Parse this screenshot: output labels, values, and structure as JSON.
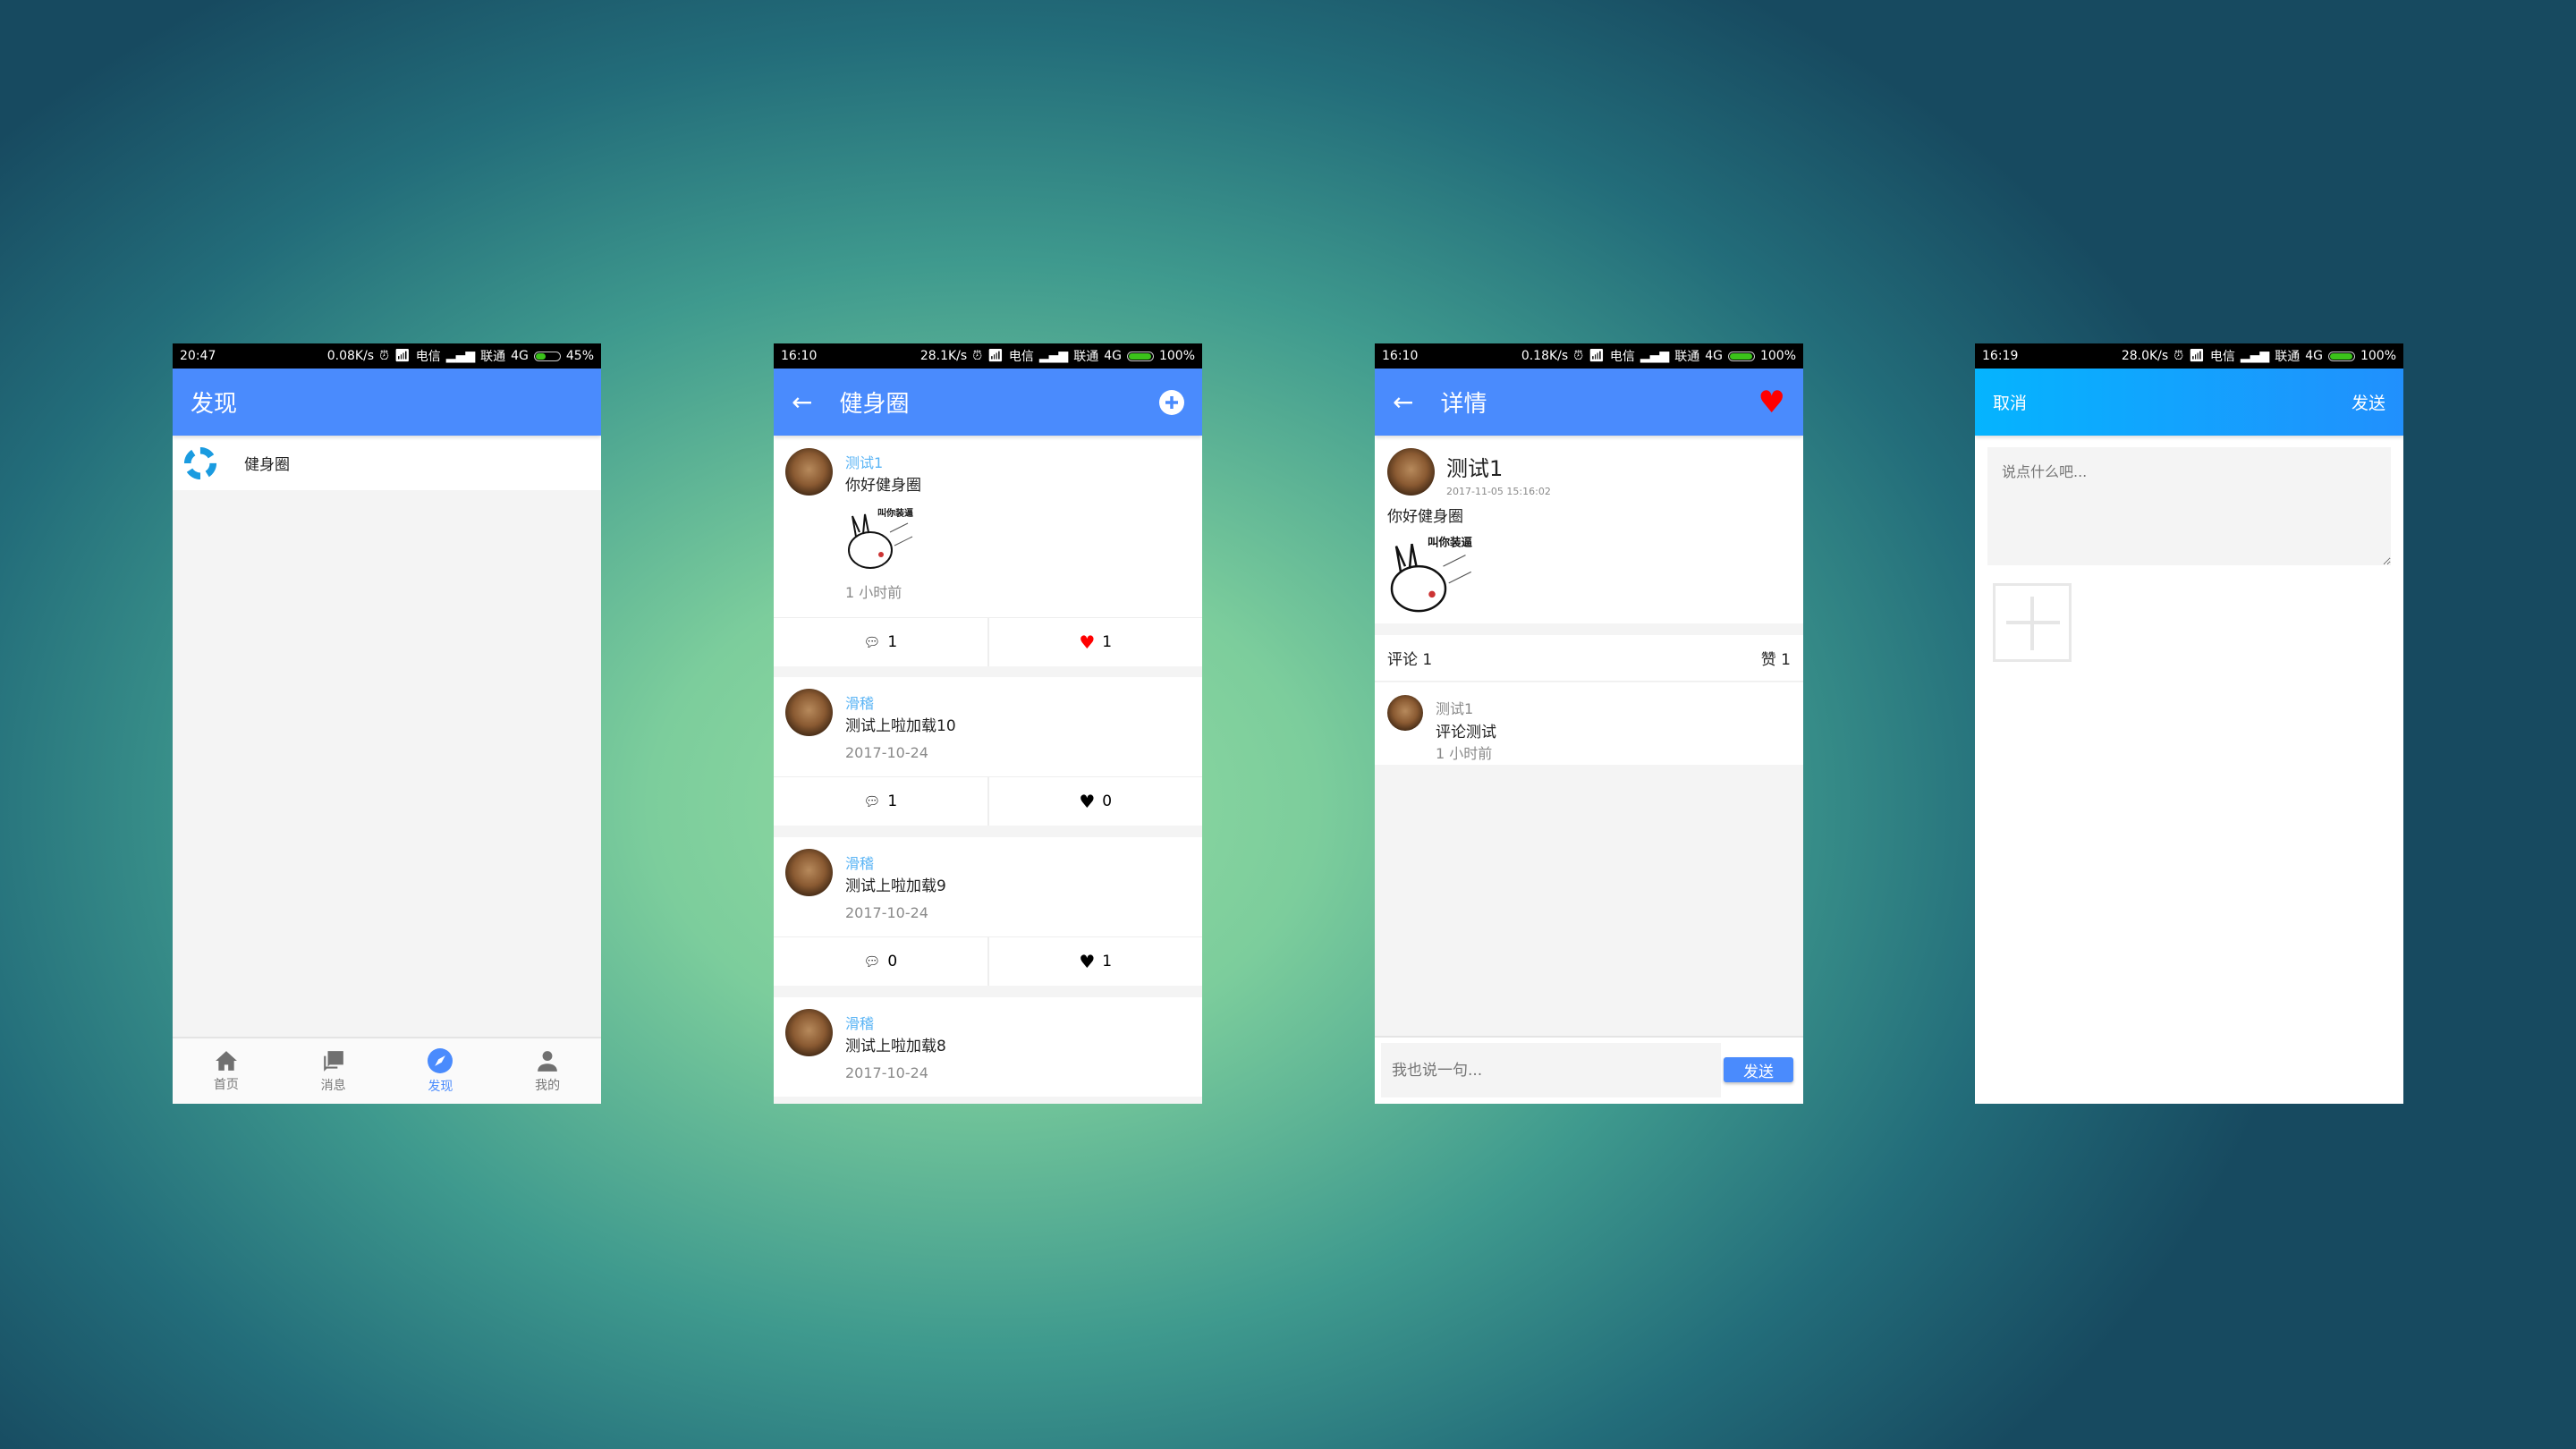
{
  "screens": [
    {
      "status": {
        "time": "20:47",
        "speed": "0.08K/s",
        "carrier1": "电信",
        "carrier2": "联通",
        "network": "4G",
        "battery": "45%"
      },
      "title": "发现",
      "items": [
        {
          "label": "健身圈",
          "icon": "fitness-circle-icon"
        }
      ],
      "tabs": [
        {
          "label": "首页",
          "icon": "home-icon"
        },
        {
          "label": "消息",
          "icon": "message-icon"
        },
        {
          "label": "发现",
          "icon": "compass-icon",
          "active": true
        },
        {
          "label": "我的",
          "icon": "user-icon"
        }
      ]
    },
    {
      "status": {
        "time": "16:10",
        "speed": "28.1K/s",
        "carrier1": "电信",
        "carrier2": "联通",
        "network": "4G",
        "battery": "100%"
      },
      "title": "健身圈",
      "posts": [
        {
          "user": "测试1",
          "text": "你好健身圈",
          "image_caption": "叫你装逼",
          "time": "1 小时前",
          "comments": "1",
          "likes": "1",
          "liked": true
        },
        {
          "user": "滑稽",
          "text": "测试上啦加载10",
          "time": "2017-10-24",
          "comments": "1",
          "likes": "0",
          "liked": false
        },
        {
          "user": "滑稽",
          "text": "测试上啦加载9",
          "time": "2017-10-24",
          "comments": "0",
          "likes": "1",
          "liked": false
        },
        {
          "user": "滑稽",
          "text": "测试上啦加载8",
          "time": "2017-10-24"
        }
      ]
    },
    {
      "status": {
        "time": "16:10",
        "speed": "0.18K/s",
        "carrier1": "电信",
        "carrier2": "联通",
        "network": "4G",
        "battery": "100%"
      },
      "title": "详情",
      "user": "测试1",
      "datetime": "2017-11-05 15:16:02",
      "text": "你好健身圈",
      "image_caption": "叫你装逼",
      "comment_count_label": "评论 1",
      "like_count_label": "赞 1",
      "comments": [
        {
          "user": "测试1",
          "text": "评论测试",
          "time": "1 小时前"
        }
      ],
      "input_placeholder": "我也说一句...",
      "send": "发送"
    },
    {
      "status": {
        "time": "16:19",
        "speed": "28.0K/s",
        "carrier1": "电信",
        "carrier2": "联通",
        "network": "4G",
        "battery": "100%"
      },
      "cancel": "取消",
      "send": "发送",
      "placeholder": "说点什么吧..."
    }
  ],
  "colors": {
    "primary": "#4a8bfd",
    "link": "#5ab4f5",
    "like": "#ff0000"
  }
}
